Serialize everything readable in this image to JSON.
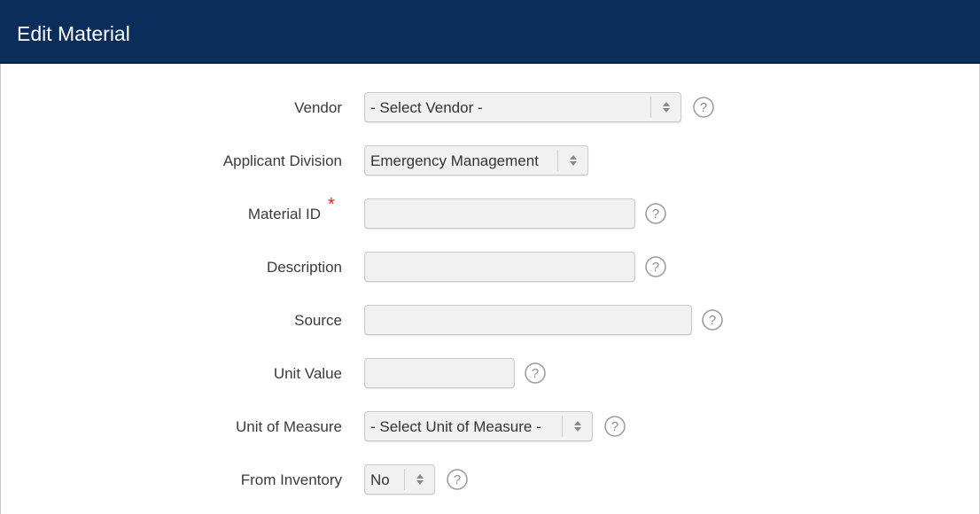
{
  "header": {
    "title": "Edit Material"
  },
  "form": {
    "vendor": {
      "label": "Vendor",
      "value": "- Select Vendor -"
    },
    "applicant_division": {
      "label": "Applicant Division",
      "value": "Emergency Management"
    },
    "material_id": {
      "label": "Material ID",
      "required_mark": "*",
      "value": ""
    },
    "description": {
      "label": "Description",
      "value": ""
    },
    "source": {
      "label": "Source",
      "value": ""
    },
    "unit_value": {
      "label": "Unit Value",
      "value": ""
    },
    "unit_of_measure": {
      "label": "Unit of Measure",
      "value": "- Select Unit of Measure -"
    },
    "from_inventory": {
      "label": "From Inventory",
      "value": "No"
    }
  },
  "icons": {
    "help": "question-circle-icon",
    "select_arrow": "sort-arrows-icon"
  },
  "colors": {
    "header_bg": "#0b2d5b",
    "required": "#d9232d",
    "field_bg": "#f1f1f1"
  }
}
